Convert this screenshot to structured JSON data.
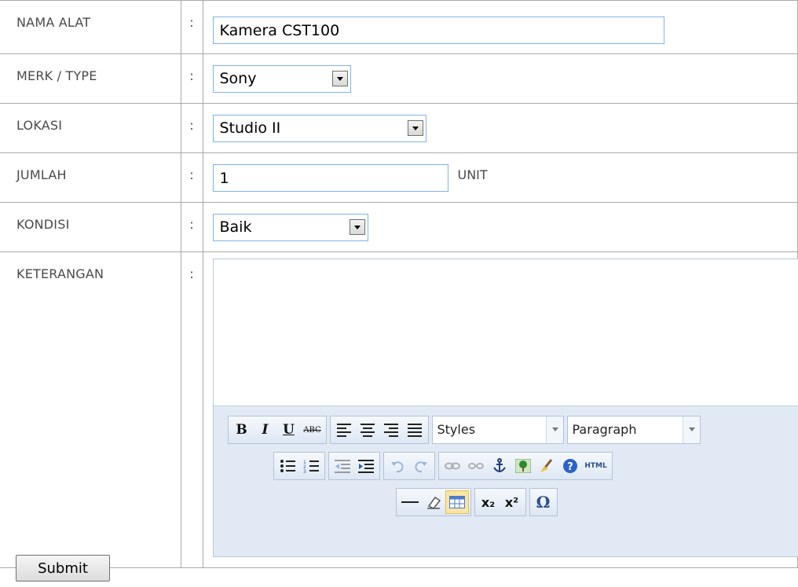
{
  "form": {
    "fields": [
      {
        "label": "NAMA ALAT",
        "colon": ":",
        "value": "Kamera CST100"
      },
      {
        "label": "MERK / TYPE",
        "colon": ":",
        "value": "Sony"
      },
      {
        "label": "LOKASI",
        "colon": ":",
        "value": "Studio II"
      },
      {
        "label": "JUMLAH",
        "colon": ":",
        "value": "1",
        "unit": "UNIT"
      },
      {
        "label": "KONDISI",
        "colon": ":",
        "value": "Baik"
      },
      {
        "label": "KETERANGAN",
        "colon": ":",
        "value": ""
      }
    ],
    "submit_label": "Submit"
  },
  "editor": {
    "toolbar": {
      "bold": "B",
      "italic": "I",
      "underline": "U",
      "strike": "ABC",
      "styles_label": "Styles",
      "format_label": "Paragraph",
      "html_label": "HTML",
      "subscript": "x₂",
      "superscript": "x²",
      "special_char": "Ω"
    }
  },
  "colors": {
    "border": "#a9a9a9",
    "input_border": "#7eb4ea",
    "toolbar_bg": "#e1e9f4"
  }
}
